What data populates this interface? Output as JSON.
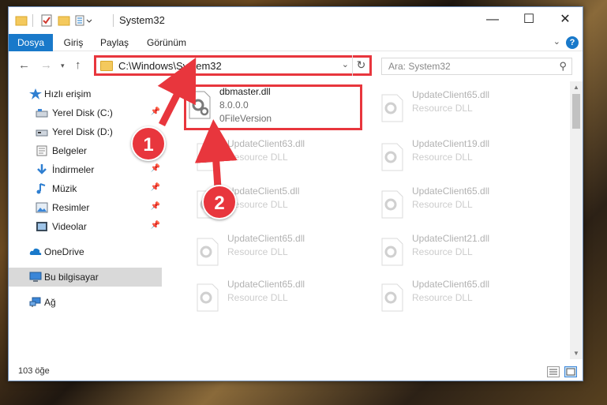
{
  "window": {
    "title": "System32",
    "controls": {
      "minimize": "—",
      "maximize": "☐",
      "close": "✕"
    }
  },
  "ribbon": {
    "tabs": [
      "Dosya",
      "Giriş",
      "Paylaş",
      "Görünüm"
    ],
    "help": "?"
  },
  "navbar": {
    "address": "C:\\Windows\\System32",
    "search_placeholder": "Ara: System32"
  },
  "nav_pane": {
    "quick_access": "Hızlı erişim",
    "items": [
      {
        "label": "Yerel Disk (C:)",
        "icon": "drive-icon",
        "pinned": true
      },
      {
        "label": "Yerel Disk (D:)",
        "icon": "drive-icon",
        "pinned": false
      },
      {
        "label": "Belgeler",
        "icon": "documents-icon",
        "pinned": true
      },
      {
        "label": "İndirmeler",
        "icon": "downloads-icon",
        "pinned": true
      },
      {
        "label": "Müzik",
        "icon": "music-icon",
        "pinned": true
      },
      {
        "label": "Resimler",
        "icon": "pictures-icon",
        "pinned": true
      },
      {
        "label": "Videolar",
        "icon": "videos-icon",
        "pinned": true
      }
    ],
    "onedrive": "OneDrive",
    "this_pc": "Bu bilgisayar",
    "network": "Ağ"
  },
  "files": {
    "featured": {
      "name": "dbmaster.dll",
      "version": "8.0.0.0",
      "file_version": "0FileVersion"
    },
    "tiles": [
      {
        "name": "UpdateClient65.dll",
        "desc": "Resource DLL"
      },
      {
        "name": "UpdateClient63.dll",
        "desc": "Resource DLL"
      },
      {
        "name": "UpdateClient19.dll",
        "desc": "Resource DLL"
      },
      {
        "name": "UpdateClient5.dll",
        "desc": "Resource DLL"
      },
      {
        "name": "UpdateClient65.dll",
        "desc": "Resource DLL"
      },
      {
        "name": "UpdateClient65.dll",
        "desc": "Resource DLL"
      },
      {
        "name": "UpdateClient21.dll",
        "desc": "Resource DLL"
      },
      {
        "name": "UpdateClient65.dll",
        "desc": "Resource DLL"
      },
      {
        "name": "UpdateClient65.dll",
        "desc": "Resource DLL"
      }
    ]
  },
  "status": {
    "item_count": "103 öğe"
  },
  "callouts": [
    "1",
    "2"
  ],
  "colors": {
    "accent": "#1979ca",
    "highlight": "#e8363d"
  }
}
